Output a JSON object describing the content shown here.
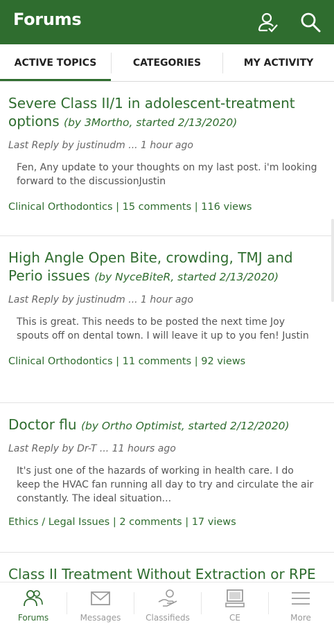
{
  "header": {
    "title": "Forums",
    "icons": [
      "user-check-icon",
      "search-icon"
    ]
  },
  "tabs": [
    {
      "label": "ACTIVE TOPICS",
      "active": true
    },
    {
      "label": "CATEGORIES",
      "active": false
    },
    {
      "label": "MY ACTIVITY",
      "active": false
    }
  ],
  "topics": [
    {
      "title": "Severe Class II/1 in adolescent-treatment options",
      "meta": "(by 3Mortho, started 2/13/2020)",
      "last_reply": "Last Reply by justinudm ... 1 hour ago",
      "snippet": "Fen, Any update to your thoughts on my last post.  i'm looking forward to the discussionJustin",
      "footer": "Clinical Orthodontics | 15 comments | 116 views"
    },
    {
      "title": "High Angle Open Bite, crowding, TMJ and Perio issues",
      "meta": "(by NyceBiteR, started 2/13/2020)",
      "last_reply": "Last Reply by justinudm ... 1 hour ago",
      "snippet": "This is great.  This needs to be posted the next time Joy spouts off on dental town.  I will leave it up to you fen! Justin",
      "footer": "Clinical Orthodontics | 11 comments | 92 views"
    },
    {
      "title": "Doctor flu",
      "meta": "(by Ortho Optimist, started 2/12/2020)",
      "last_reply": "Last Reply by Dr-T ... 11 hours ago",
      "snippet": "It's just one of the hazards of working in health care. I do keep the HVAC fan running all day to try and circulate the air constantly. The ideal situation...",
      "footer": "Ethics / Legal Issues | 2 comments | 17 views"
    },
    {
      "title": "Class II Treatment Without Extraction or RPE",
      "meta": "",
      "last_reply": "",
      "snippet": "",
      "footer": ""
    }
  ],
  "bottom_nav": [
    {
      "label": "Forums",
      "icon": "people-icon",
      "active": true
    },
    {
      "label": "Messages",
      "icon": "envelope-icon",
      "active": false
    },
    {
      "label": "Classifieds",
      "icon": "hand-coin-icon",
      "active": false
    },
    {
      "label": "CE",
      "icon": "computer-icon",
      "active": false
    },
    {
      "label": "More",
      "icon": "hamburger-menu-icon",
      "active": false
    }
  ],
  "colors": {
    "brand_green": "#2f6d2f",
    "text_gray": "#555555",
    "inactive_nav": "#9a9a9a"
  }
}
